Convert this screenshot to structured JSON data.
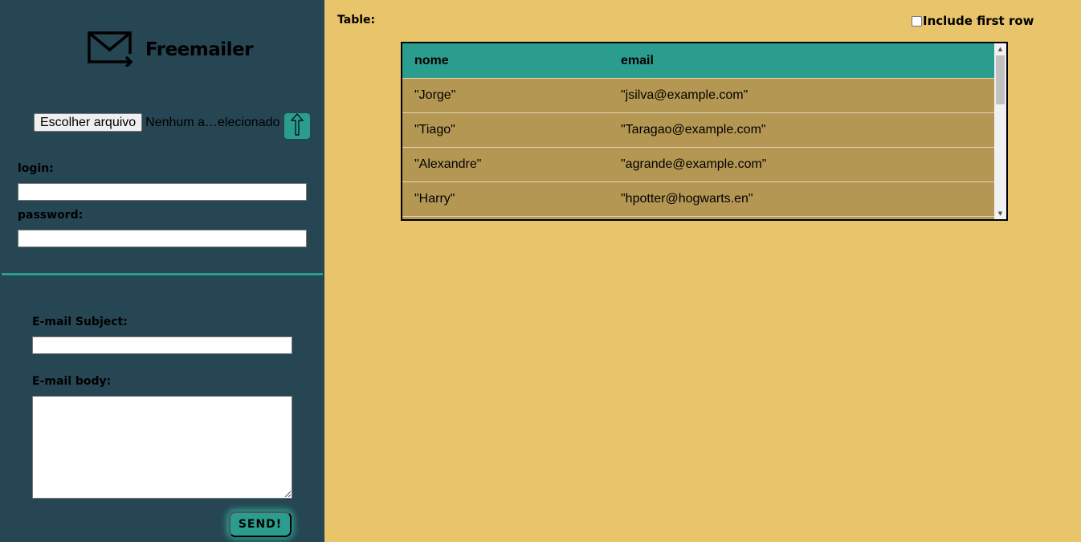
{
  "app": {
    "name": "Freemailer",
    "logo_icon": "envelope-icon"
  },
  "file_input": {
    "button_label": "Escolher arquivo",
    "status_text": "Nenhum a…elecionado",
    "upload_icon": "arrow-up-icon"
  },
  "auth": {
    "login_label": "login:",
    "login_value": "",
    "password_label": "password:",
    "password_value": ""
  },
  "email": {
    "subject_label": "E-mail Subject:",
    "subject_value": "",
    "body_label": "E-mail body:",
    "body_value": "",
    "send_label": "SEND!"
  },
  "table": {
    "title": "Table:",
    "include_first_row_label": "Include first row",
    "include_first_row_checked": false,
    "columns": [
      "nome",
      "email"
    ],
    "rows": [
      [
        "\"Jorge\"",
        "\"jsilva@example.com\""
      ],
      [
        "\"Tiago\"",
        "\"Taragao@example.com\""
      ],
      [
        "\"Alexandre\"",
        "\"agrande@example.com\""
      ],
      [
        "\"Harry\"",
        "\"hpotter@hogwarts.en\""
      ]
    ]
  },
  "colors": {
    "sidebar": "#264653",
    "accent": "#2a9d8f",
    "background": "#e8c46b",
    "row": "#b59754"
  }
}
